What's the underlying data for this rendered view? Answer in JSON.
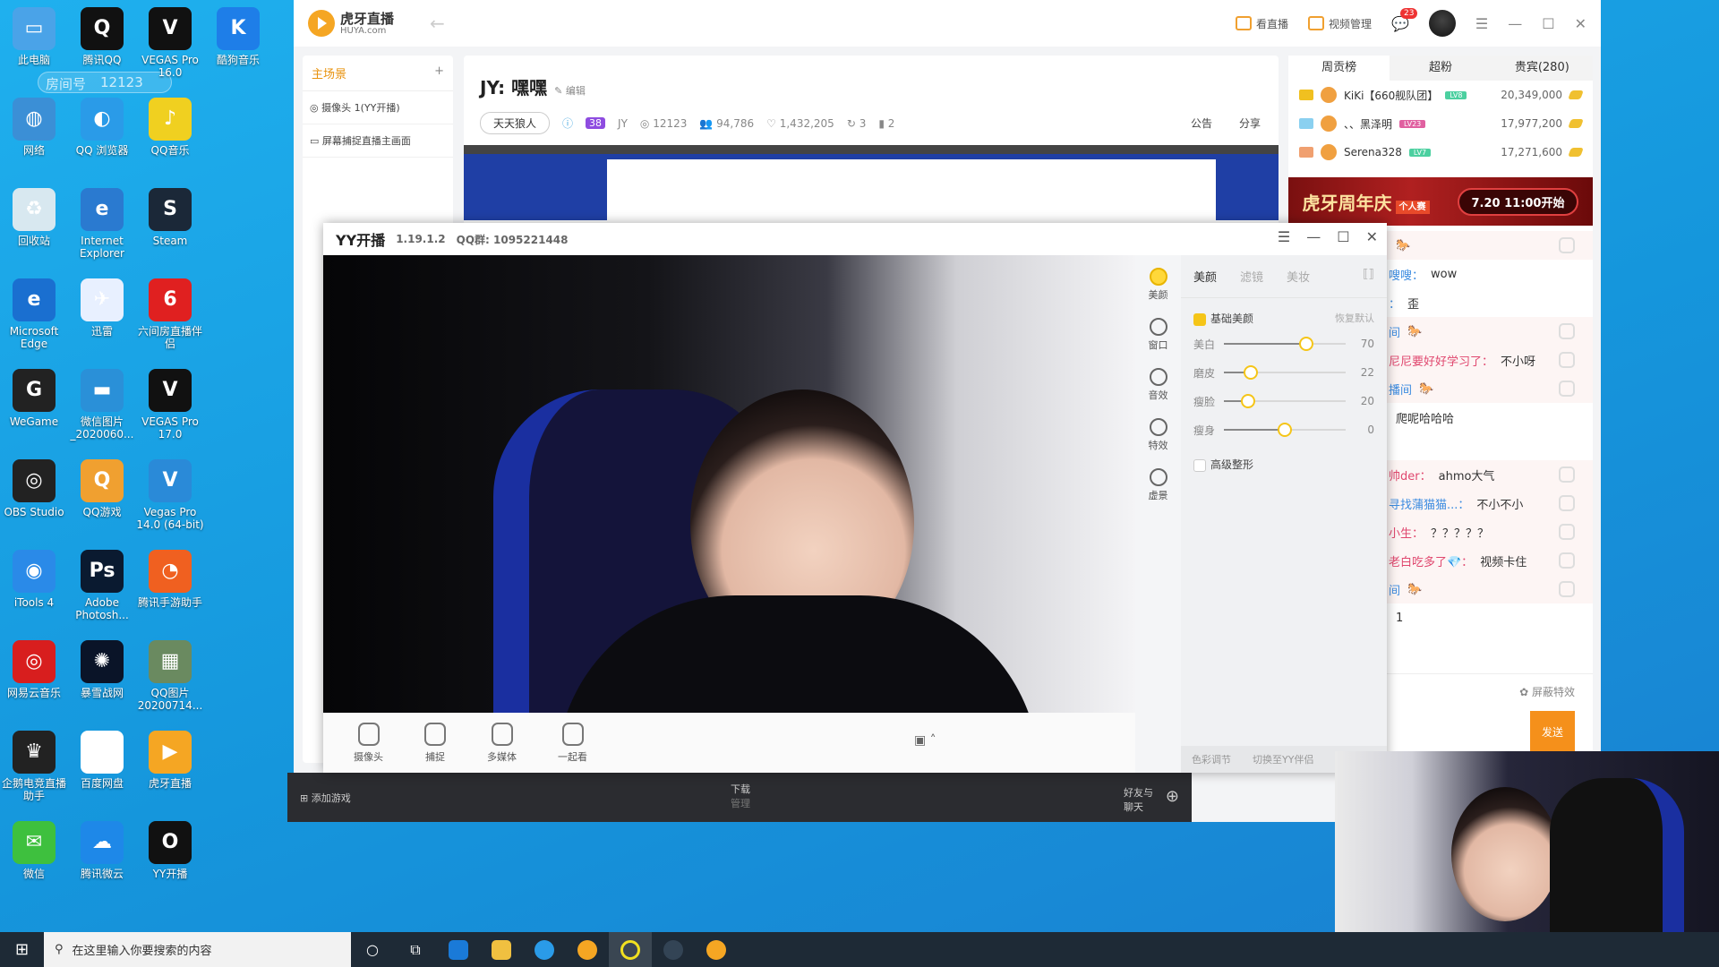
{
  "desktop": {
    "watermark": {
      "label": "房间号",
      "room": "12123"
    },
    "icons": [
      {
        "label": "此电脑",
        "color": "#4aa3e8",
        "glyph": "▭"
      },
      {
        "label": "腾讯QQ",
        "color": "#111",
        "glyph": "Q"
      },
      {
        "label": "VEGAS Pro 16.0",
        "color": "#111",
        "glyph": "V"
      },
      {
        "label": "酷狗音乐",
        "color": "#1e7ee8",
        "glyph": "K"
      },
      {
        "label": "网络",
        "color": "#3b8fd6",
        "glyph": "◍"
      },
      {
        "label": "QQ 浏览器",
        "color": "#2a9be8",
        "glyph": "◐"
      },
      {
        "label": "QQ音乐",
        "color": "#f0d020",
        "glyph": "♪"
      },
      {
        "label": "回收站",
        "color": "#d8e8f0",
        "glyph": "♻"
      },
      {
        "label": "Internet Explorer",
        "color": "#2a7ad0",
        "glyph": "e"
      },
      {
        "label": "Steam",
        "color": "#1b2838",
        "glyph": "S"
      },
      {
        "label": "Microsoft Edge",
        "color": "#1a6fd0",
        "glyph": "e"
      },
      {
        "label": "迅雷",
        "color": "#e8f0ff",
        "glyph": "✈"
      },
      {
        "label": "六间房直播伴侣",
        "color": "#e02020",
        "glyph": "6"
      },
      {
        "label": "WeGame",
        "color": "#222",
        "glyph": "G"
      },
      {
        "label": "微信图片_2020060...",
        "color": "#2a90d8",
        "glyph": "▬"
      },
      {
        "label": "VEGAS Pro 17.0",
        "color": "#111",
        "glyph": "V"
      },
      {
        "label": "OBS Studio",
        "color": "#222",
        "glyph": "◎"
      },
      {
        "label": "QQ游戏",
        "color": "#f0a030",
        "glyph": "Q"
      },
      {
        "label": "Vegas Pro 14.0 (64-bit)",
        "color": "#2a8ad8",
        "glyph": "V"
      },
      {
        "label": "iTools 4",
        "color": "#2a8ae8",
        "glyph": "◉"
      },
      {
        "label": "Adobe Photosh...",
        "color": "#0a1a30",
        "glyph": "Ps"
      },
      {
        "label": "腾讯手游助手",
        "color": "#f06020",
        "glyph": "◔"
      },
      {
        "label": "网易云音乐",
        "color": "#d81e1e",
        "glyph": "◎"
      },
      {
        "label": "暴雪战网",
        "color": "#0a1428",
        "glyph": "✺"
      },
      {
        "label": "QQ图片20200714...",
        "color": "#6a8a60",
        "glyph": "▦"
      },
      {
        "label": "企鹅电竞直播助手",
        "color": "#222",
        "glyph": "♛"
      },
      {
        "label": "百度网盘",
        "color": "#fff",
        "glyph": "∞"
      },
      {
        "label": "虎牙直播",
        "color": "#f5a623",
        "glyph": "▶"
      },
      {
        "label": "微信",
        "color": "#3ec03e",
        "glyph": "✉"
      },
      {
        "label": "腾讯微云",
        "color": "#1e88e8",
        "glyph": "☁"
      },
      {
        "label": "YY开播",
        "color": "#111",
        "glyph": "O"
      }
    ]
  },
  "huya": {
    "logo": {
      "name": "虎牙直播",
      "domain": "HUYA.com"
    },
    "top": {
      "watch": "看直播",
      "video_mgmt": "视频管理",
      "msg_count": "23"
    },
    "sidebar": {
      "scene": "主场景",
      "items": [
        "摄像头 1(YY开播)",
        "屏幕捕捉直播主画面"
      ]
    },
    "title": "JY: 嘿嘿",
    "edit": "编辑",
    "info": {
      "category": "天天狼人",
      "level": "38",
      "name": "JY",
      "room": "12123",
      "fans": "94,786",
      "likes": "1,432,205",
      "share": "3",
      "rank": "2",
      "notice": "公告",
      "share_label": "分享"
    },
    "right": {
      "tabs": [
        "周贡榜",
        "超粉",
        "贵宾(280)"
      ],
      "ranks": [
        {
          "name": "KiKi【660舰队团】",
          "level": "LV8",
          "amount": "20,349,000",
          "medal": "#f0c020",
          "lvcolor": "#4cd0a0"
        },
        {
          "name": "、、黑泽明",
          "level": "LV23",
          "amount": "17,977,200",
          "medal": "#8ad0f0",
          "lvcolor": "#e060a0"
        },
        {
          "name": "Serena328",
          "level": "LV7",
          "amount": "17,271,600",
          "medal": "#f0a070",
          "lvcolor": "#4cd0a0"
        }
      ],
      "banner": {
        "title": "虎牙周年庆",
        "sub": "个人赛",
        "time": "7.20 11:00开始"
      },
      "chat": [
        {
          "user": "",
          "text": "🐎",
          "gift": true
        },
        {
          "user": "嗖嗖：",
          "text": "wow",
          "color": "blue"
        },
        {
          "user": "：",
          "text": "歪",
          "color": "blue"
        },
        {
          "user": "间",
          "text": "🐎",
          "gift": true
        },
        {
          "user": "尼尼要好好学习了：",
          "text": "不小呀",
          "color": "red",
          "gift": true
        },
        {
          "user": "播间",
          "text": "🐎",
          "gift": true
        },
        {
          "user": "",
          "text": "爬呢哈哈哈"
        },
        {
          "user": "",
          "text": ""
        },
        {
          "user": "帅der：",
          "text": "ahmo大气",
          "color": "red",
          "gift": true
        },
        {
          "user": "寻找蒲猫猫...：",
          "text": "不小不小",
          "color": "blue",
          "gift": true
        },
        {
          "user": "小生：",
          "text": "？？？？？",
          "color": "red",
          "gift": true
        },
        {
          "user": "老白吃多了💎：",
          "text": "视频卡住",
          "color": "red",
          "gift": true
        },
        {
          "user": "间",
          "text": "🐎",
          "gift": true
        },
        {
          "user": "",
          "text": "1"
        }
      ],
      "block_effects": "屏蔽特效",
      "send": "发送"
    },
    "bottom": {
      "add_game": "添加游戏",
      "download": "下载",
      "manage": "管理",
      "friends": "好友与聊天"
    }
  },
  "yy": {
    "title": "YY开播",
    "version": "1.19.1.2",
    "qq_group": "QQ群: 1095221448",
    "side": [
      "美颜",
      "窗口",
      "音效",
      "特效",
      "虚景"
    ],
    "tabs": [
      "美颜",
      "滤镜",
      "美妆"
    ],
    "basic": "基础美颜",
    "reset": "恢复默认",
    "sliders": [
      {
        "label": "美白",
        "value": 70,
        "pos": 0.68
      },
      {
        "label": "磨皮",
        "value": 22,
        "pos": 0.22
      },
      {
        "label": "瘦脸",
        "value": 20,
        "pos": 0.2
      },
      {
        "label": "瘦身",
        "value": 0,
        "pos": 0.5
      }
    ],
    "advanced": "高级整形",
    "footer": [
      "色彩调节",
      "切换至YY伴侣"
    ],
    "toolbar": [
      "摄像头",
      "捕捉",
      "多媒体",
      "一起看"
    ]
  },
  "taskbar": {
    "search_placeholder": "在这里输入你要搜索的内容"
  }
}
